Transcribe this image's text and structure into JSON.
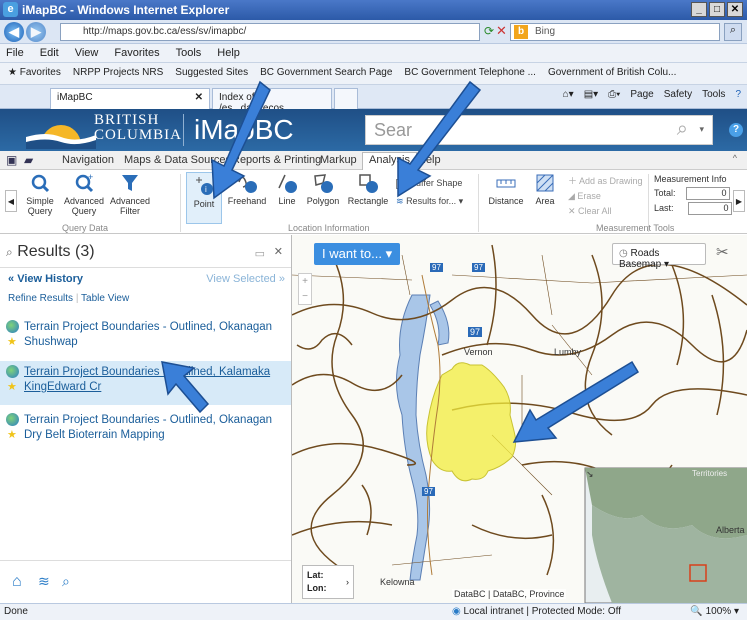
{
  "browser": {
    "title": "iMapBC - Windows Internet Explorer",
    "url": "http://maps.gov.bc.ca/ess/sv/imapbc/",
    "search_placeholder": "Bing",
    "menu": [
      "File",
      "Edit",
      "View",
      "Favorites",
      "Tools",
      "Help"
    ],
    "favorites": [
      "Favorites",
      "NRPP Projects NRS",
      "Suggested Sites",
      "BC Government Search Page",
      "BC Government Telephone ...",
      "Government of British Colu..."
    ],
    "tabs": [
      "iMapBC",
      "Index of /es...data/ecos..."
    ],
    "commands": [
      "Page",
      "Safety",
      "Tools"
    ],
    "status_left": "Done",
    "status_zone": "Local intranet | Protected Mode: Off",
    "zoom": "100%"
  },
  "app": {
    "org_line1": "BRITISH",
    "org_line2": "COLUMBIA",
    "name": "iMapBC",
    "search_placeholder": "Sear"
  },
  "ribbon_tabs": [
    "Navigation",
    "Maps & Data Sources",
    "Reports & Printing",
    "Markup",
    "Analysis",
    "Help"
  ],
  "ribbon": {
    "query": {
      "buttons": [
        "Simple Query",
        "Advanced Query",
        "Advanced Filter"
      ],
      "label": "Query Data"
    },
    "location": {
      "buttons": [
        "Point",
        "Freehand",
        "Line",
        "Polygon",
        "Rectangle"
      ],
      "buffer": "Buffer Shape",
      "results_for": "Results for...",
      "label": "Location Information"
    },
    "measure": {
      "buttons": [
        "Distance",
        "Area"
      ],
      "add_drawing": "Add as Drawing",
      "erase": "Erase",
      "clear_all": "Clear All",
      "info_title": "Measurement Info",
      "total": "Total:",
      "last": "Last:",
      "label": "Measurement Tools"
    }
  },
  "results": {
    "title": "Results (3)",
    "view_history": "View History",
    "view_selected": "View Selected",
    "refine": "Refine Results",
    "table_view": "Table View",
    "items": [
      {
        "line1": "Terrain Project Boundaries - Outlined, Okanagan",
        "line2": "Shushwap"
      },
      {
        "line1": "Terrain Project Boundaries - Outlined, Kalamaka",
        "line2": "KingEdward Cr"
      },
      {
        "line1": "Terrain Project Boundaries - Outlined, Okanagan",
        "line2": "Dry Belt Bioterrain Mapping"
      }
    ]
  },
  "map": {
    "i_want_to": "I want to...",
    "basemap": "Roads Basemap",
    "town": "Vernon",
    "lumby": "Lumby",
    "kelowna": "Kelowna",
    "hwy_labels": [
      "97",
      "97",
      "97",
      "97"
    ],
    "lat": "Lat:",
    "lon": "Lon:",
    "attribution": "DataBC | DataBC, Province",
    "overview_label1": "Territories",
    "overview_label2": "Alberta"
  },
  "colors": {
    "accent": "#1f5f99",
    "highlight": "#f2ec3c",
    "arrow": "#3a7fd8"
  }
}
